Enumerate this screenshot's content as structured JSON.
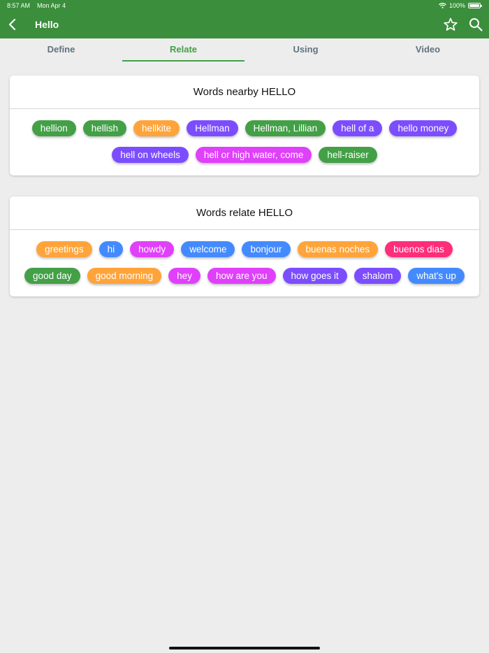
{
  "status_bar": {
    "time": "8:57 AM",
    "date": "Mon Apr 4",
    "battery": "100%",
    "battery_level": 1.0
  },
  "app_bar": {
    "title": "Hello",
    "back_icon": "chevron-left-icon",
    "favorite_icon": "star-outline-icon",
    "search_icon": "search-icon"
  },
  "tabs": [
    {
      "label": "Define",
      "active": false
    },
    {
      "label": "Relate",
      "active": true
    },
    {
      "label": "Using",
      "active": false
    },
    {
      "label": "Video",
      "active": false
    }
  ],
  "colors": {
    "primary": "#3b8e3c",
    "green": "#43a047",
    "orange": "#ffa43a",
    "purple": "#7c4dff",
    "magenta": "#e040fb",
    "blue": "#448aff",
    "pink": "#ff2d7a"
  },
  "nearby": {
    "title": "Words nearby HELLO",
    "words": [
      {
        "text": "hellion",
        "color": "#43a047"
      },
      {
        "text": "hellish",
        "color": "#43a047"
      },
      {
        "text": "hellkite",
        "color": "#ffa43a"
      },
      {
        "text": "Hellman",
        "color": "#7c4dff"
      },
      {
        "text": "Hellman, Lillian",
        "color": "#43a047"
      },
      {
        "text": "hell of a",
        "color": "#7c4dff"
      },
      {
        "text": "hello money",
        "color": "#7c4dff"
      },
      {
        "text": "hell on wheels",
        "color": "#7c4dff"
      },
      {
        "text": "hell or high water, come",
        "color": "#e040fb"
      },
      {
        "text": "hell-raiser",
        "color": "#43a047"
      }
    ]
  },
  "related": {
    "title": "Words relate HELLO",
    "words": [
      {
        "text": "greetings",
        "color": "#ffa43a"
      },
      {
        "text": "hi",
        "color": "#448aff"
      },
      {
        "text": "howdy",
        "color": "#e040fb"
      },
      {
        "text": "welcome",
        "color": "#448aff"
      },
      {
        "text": "bonjour",
        "color": "#448aff"
      },
      {
        "text": "buenas noches",
        "color": "#ffa43a"
      },
      {
        "text": "buenos dias",
        "color": "#ff2d7a"
      },
      {
        "text": "good day",
        "color": "#43a047"
      },
      {
        "text": "good morning",
        "color": "#ffa43a"
      },
      {
        "text": "hey",
        "color": "#e040fb"
      },
      {
        "text": "how are you",
        "color": "#e040fb"
      },
      {
        "text": "how goes it",
        "color": "#7c4dff"
      },
      {
        "text": "shalom",
        "color": "#7c4dff"
      },
      {
        "text": "what's up",
        "color": "#448aff"
      }
    ]
  }
}
